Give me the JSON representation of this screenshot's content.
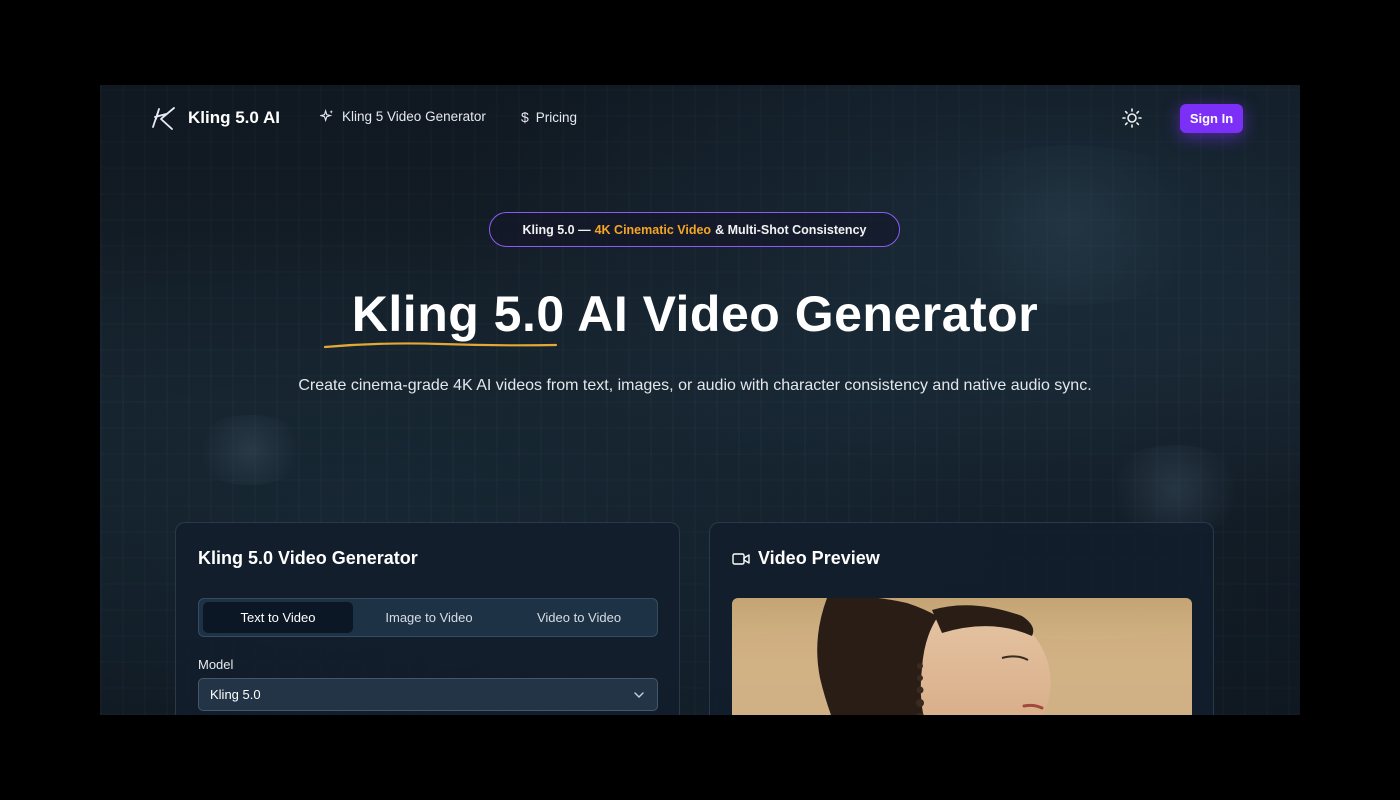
{
  "nav": {
    "brand": "Kling 5.0 AI",
    "links": [
      {
        "label": "Kling 5 Video Generator",
        "icon": "sparkles-icon"
      },
      {
        "label": "Pricing",
        "icon": "dollar-icon"
      }
    ],
    "theme_icon": "sun-icon",
    "signin_label": "Sign In"
  },
  "badge": {
    "prefix": "Kling 5.0 —",
    "highlight": "4K Cinematic Video",
    "suffix": "& Multi-Shot Consistency"
  },
  "hero": {
    "title": "Kling 5.0 AI Video Generator",
    "subtitle": "Create cinema-grade 4K AI videos from text, images, or audio with character consistency and native audio sync."
  },
  "generator": {
    "title": "Kling 5.0 Video Generator",
    "tabs": [
      {
        "label": "Text to Video",
        "active": true
      },
      {
        "label": "Image to Video",
        "active": false
      },
      {
        "label": "Video to Video",
        "active": false
      }
    ],
    "model_label": "Model",
    "model_value": "Kling 5.0"
  },
  "preview": {
    "title": "Video Preview",
    "icon": "video-camera-icon"
  },
  "colors": {
    "accent": "#7b2ff7",
    "highlight": "#f5a623",
    "badge_border": "#8a5cf6"
  }
}
